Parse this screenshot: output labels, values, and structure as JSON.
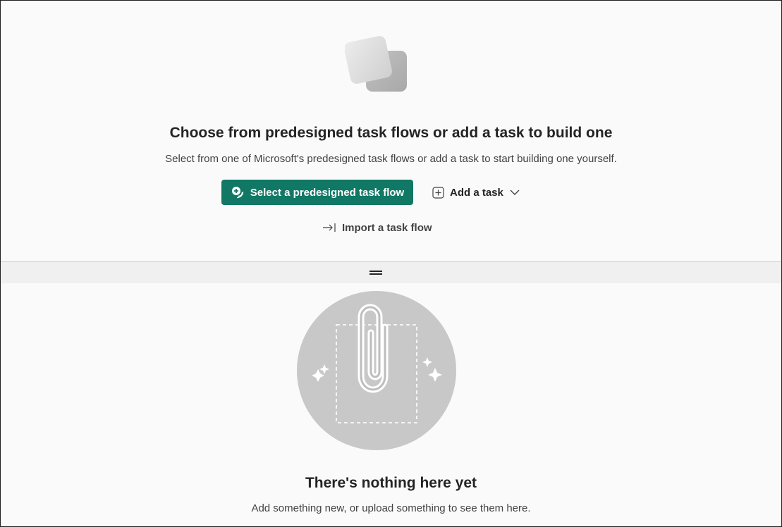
{
  "task_flow_pane": {
    "illustration": "stacked-cards-illustration",
    "title": "Choose from predesigned task flows or add a task to build one",
    "subtitle": "Select from one of Microsoft's predesigned task flows or add a task to start building one yourself.",
    "primary_button": {
      "label": "Select a predesigned task flow",
      "icon": "task-flow-icon"
    },
    "add_task_button": {
      "label": "Add a task",
      "icon": "add-square-icon",
      "dropdown_icon": "chevron-down-icon"
    },
    "import_button": {
      "label": "Import a task flow",
      "icon": "arrow-import-icon"
    }
  },
  "splitter": {
    "icon": "resize-handle-icon"
  },
  "items_pane": {
    "illustration": "paperclip-empty-illustration",
    "title": "There's nothing here yet",
    "subtitle": "Add something new, or upload something to see them here."
  },
  "colors": {
    "primary": "#117865",
    "text": "#242424",
    "secondary_text": "#424242",
    "background": "#fafafa",
    "splitter": "#f0f0f0",
    "illustration_gray": "#c8c8c8"
  }
}
